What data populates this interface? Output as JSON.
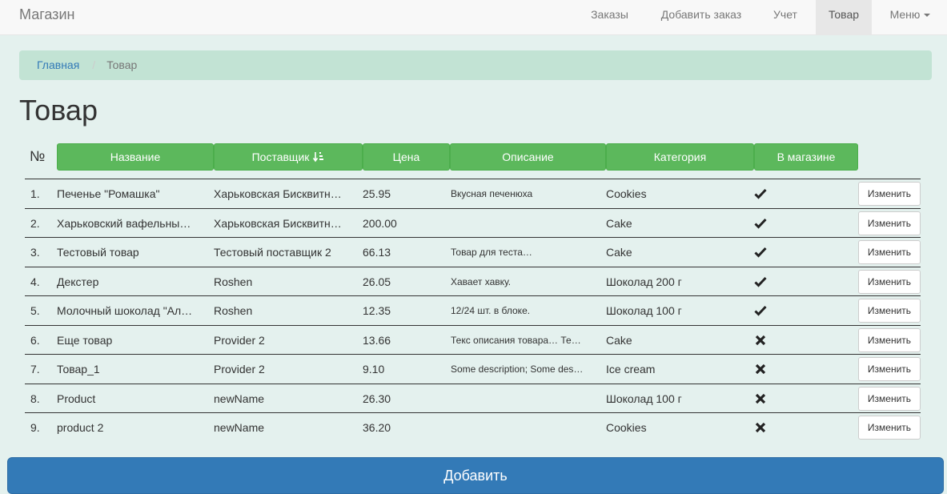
{
  "navbar": {
    "brand": "Магазин",
    "items": [
      {
        "label": "Заказы"
      },
      {
        "label": "Добавить заказ"
      },
      {
        "label": "Учет"
      },
      {
        "label": "Товар",
        "active": true
      },
      {
        "label": "Меню",
        "dropdown": true
      }
    ]
  },
  "breadcrumb": {
    "home": "Главная",
    "separator": "/",
    "current": "Товар"
  },
  "page_title": "Товар",
  "table": {
    "number_header": "№",
    "headers": {
      "name": "Название",
      "supplier": "Поставщик",
      "price": "Цена",
      "description": "Описание",
      "category": "Категория",
      "in_store": "В магазине"
    },
    "sort_icon": "sort-amount-icon",
    "header_color": "#5cb85c",
    "rows": [
      {
        "num": "1.",
        "name": "Печенье \"Ромашка\"",
        "supplier": "Харьковская Бисквитн…",
        "price": "25.95",
        "description": "Вкусная печенюха",
        "category": "Cookies",
        "in_store": true,
        "edit": "Изменить"
      },
      {
        "num": "2.",
        "name": "Харьковский вафельны…",
        "supplier": "Харьковская Бисквитн…",
        "price": "200.00",
        "description": "",
        "category": "Cake",
        "in_store": true,
        "edit": "Изменить"
      },
      {
        "num": "3.",
        "name": "Тестовый товар",
        "supplier": "Тестовый поставщик 2",
        "price": "66.13",
        "description": "Товар для теста…",
        "category": "Cake",
        "in_store": true,
        "edit": "Изменить"
      },
      {
        "num": "4.",
        "name": "Декстер",
        "supplier": "Roshen",
        "price": "26.05",
        "description": "Хавает хавку.",
        "category": "Шоколад 200 г",
        "in_store": true,
        "edit": "Изменить"
      },
      {
        "num": "5.",
        "name": "Молочный шоколад \"Ал…",
        "supplier": "Roshen",
        "price": "12.35",
        "description": "12/24 шт. в блоке.",
        "category": "Шоколад 100 г",
        "in_store": true,
        "edit": "Изменить"
      },
      {
        "num": "6.",
        "name": "Еще товар",
        "supplier": "Provider 2",
        "price": "13.66",
        "description": "Текс описания товара… Те…",
        "category": "Cake",
        "in_store": false,
        "edit": "Изменить"
      },
      {
        "num": "7.",
        "name": "Товар_1",
        "supplier": "Provider 2",
        "price": "9.10",
        "description": "Some description; Some des…",
        "category": "Ice cream",
        "in_store": false,
        "edit": "Изменить"
      },
      {
        "num": "8.",
        "name": "Product",
        "supplier": "newName",
        "price": "26.30",
        "description": "",
        "category": "Шоколад 100 г",
        "in_store": false,
        "edit": "Изменить"
      },
      {
        "num": "9.",
        "name": "product 2",
        "supplier": "newName",
        "price": "36.20",
        "description": "",
        "category": "Cookies",
        "in_store": false,
        "edit": "Изменить"
      }
    ]
  },
  "add_button": "Добавить",
  "colors": {
    "background": "#e4f1ee",
    "breadcrumb_bg": "#c2e3d4",
    "primary": "#337ab7",
    "success": "#5cb85c"
  }
}
